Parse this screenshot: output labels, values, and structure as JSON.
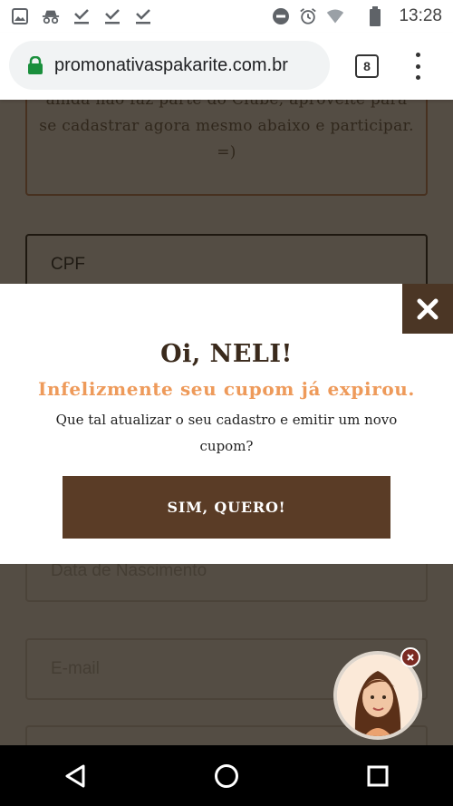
{
  "status_bar": {
    "time": "13:28",
    "left_icons": [
      "image-icon",
      "incognito-icon",
      "download-done-icon",
      "download-done-icon",
      "download-done-icon"
    ],
    "right_icons": [
      "do-not-disturb-icon",
      "alarm-icon",
      "wifi-icon",
      "battery-icon"
    ]
  },
  "browser": {
    "url": "promonativaspakarite.com.br",
    "tab_count": "8",
    "accent_color": "#1a8f3c"
  },
  "page": {
    "info_text": "ainda não faz parte do Clube, aproveite para se cadastrar agora mesmo abaixo e participar. =)",
    "fields": {
      "cpf": "CPF",
      "birth_date": "Data de Nascimento",
      "email": "E-mail"
    }
  },
  "modal": {
    "title": "Oi, NELI!",
    "subtitle": "Infelizmente seu cupom já expirou.",
    "body": "Que tal atualizar o seu cadastro e emitir um novo cupom?",
    "cta_label": "SIM, QUERO!",
    "brand_color": "#5a3c26",
    "highlight_color": "#ee9a5a"
  },
  "nav_bar": {
    "icons": [
      "back-icon",
      "home-icon",
      "recents-icon"
    ]
  }
}
